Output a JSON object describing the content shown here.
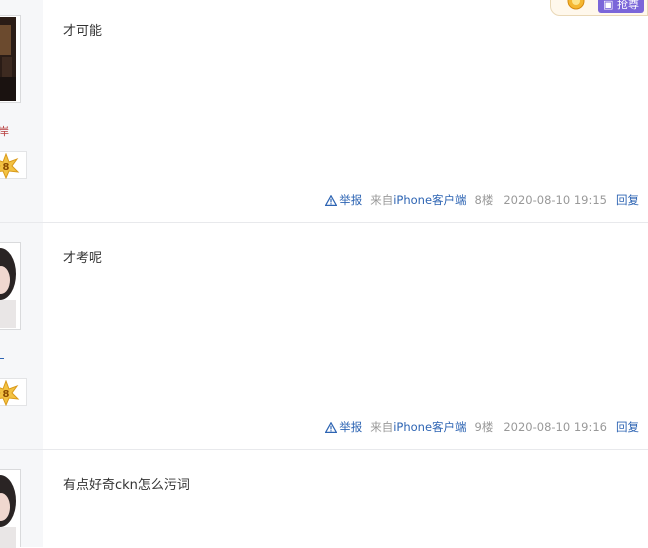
{
  "top_widget": {
    "button_label": "抢尊"
  },
  "footer": {
    "report_label": "举报",
    "from_prefix": "来自",
    "client_label": "iPhone客户端",
    "reply_label": "回复"
  },
  "posts": [
    {
      "content": "才可能",
      "username_fragment": "岸",
      "level": "8",
      "floor": "8楼",
      "time": "2020-08-10 19:15"
    },
    {
      "content": "才考呢",
      "username_fragment": "",
      "level": "8",
      "floor": "9楼",
      "time": "2020-08-10 19:16"
    },
    {
      "content": "有点好奇ckn怎么污词"
    }
  ]
}
